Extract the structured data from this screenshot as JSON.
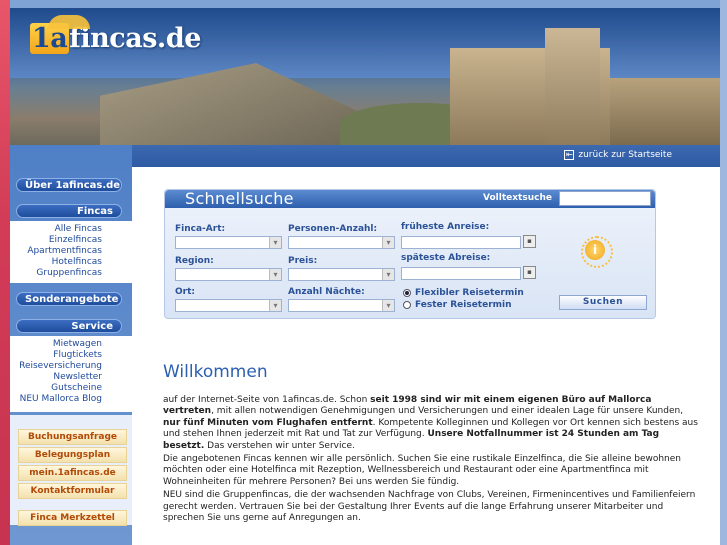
{
  "header": {
    "logo_prefix": "1a",
    "logo_suffix": "fincas.de",
    "back_link": "zurück zur Startseite"
  },
  "sidebar": {
    "ueber": "Über 1afincas.de",
    "fincas_head": "Fincas",
    "fincas_items": [
      "Alle Fincas",
      "Einzelfincas",
      "Apartmentfincas",
      "Hotelfincas",
      "Gruppenfincas"
    ],
    "sonderangebote": "Sonderangebote",
    "service_head": "Service",
    "service_items": [
      "Mietwagen",
      "Flugtickets",
      "Reiseversicherung",
      "Newsletter",
      "Gutscheine",
      "NEU Mallorca Blog"
    ],
    "buchungsanfrage": "Buchungsanfrage",
    "belegungsplan": "Belegungsplan",
    "mein": "mein.1afincas.de",
    "kontakt": "Kontaktformular",
    "merkzettel": "Finca Merkzettel"
  },
  "search": {
    "title": "Schnellsuche",
    "fulltext_label": "Volltextsuche",
    "finca_art": "Finca-Art:",
    "personen": "Personen-Anzahl:",
    "frueheste": "früheste Anreise:",
    "region": "Region:",
    "preis": "Preis:",
    "spaeteste": "späteste Abreise:",
    "ort": "Ort:",
    "naechte": "Anzahl Nächte:",
    "flex": "Flexibler Reisetermin",
    "fest": "Fester Reisetermin",
    "button": "Suchen",
    "info_icon": "i"
  },
  "welcome": {
    "title": "Willkommen",
    "p1_a": "auf der Internet-Seite von 1afincas.de. Schon ",
    "p1_b": "seit 1998 sind wir mit einem eigenen Büro auf Mallorca vertreten",
    "p1_c": ", mit allen notwendigen Genehmigungen und Versicherungen und einer idealen Lage für unsere Kunden, ",
    "p1_d": "nur fünf Minuten vom Flughafen entfernt",
    "p1_e": ". Kompetente Kolleginnen und Kollegen vor Ort kennen sich bestens aus und stehen Ihnen jederzeit mit Rat und Tat zur Verfügung. ",
    "p1_f": "Unsere Notfallnummer ist 24 Stunden am Tag besetzt.",
    "p1_g": " Das verstehen wir unter Service.",
    "p2": "Die angebotenen Fincas kennen wir alle persönlich. Suchen Sie eine rustikale Einzelfinca, die Sie alleine bewohnen möchten oder eine Hotelfinca mit Rezeption, Wellnessbereich und Restaurant oder eine Apartmentfinca mit Wohneinheiten für mehrere Personen? Bei uns werden Sie fündig.",
    "p3": "NEU sind die Gruppenfincas, die der wachsenden Nachfrage von Clubs, Vereinen, Firmenincentives und Familienfeiern gerecht werden. Vertrauen Sie bei der Gestaltung Ihrer Events auf die lange Erfahrung unserer Mitarbeiter und sprechen Sie uns gerne auf Anregungen an."
  }
}
